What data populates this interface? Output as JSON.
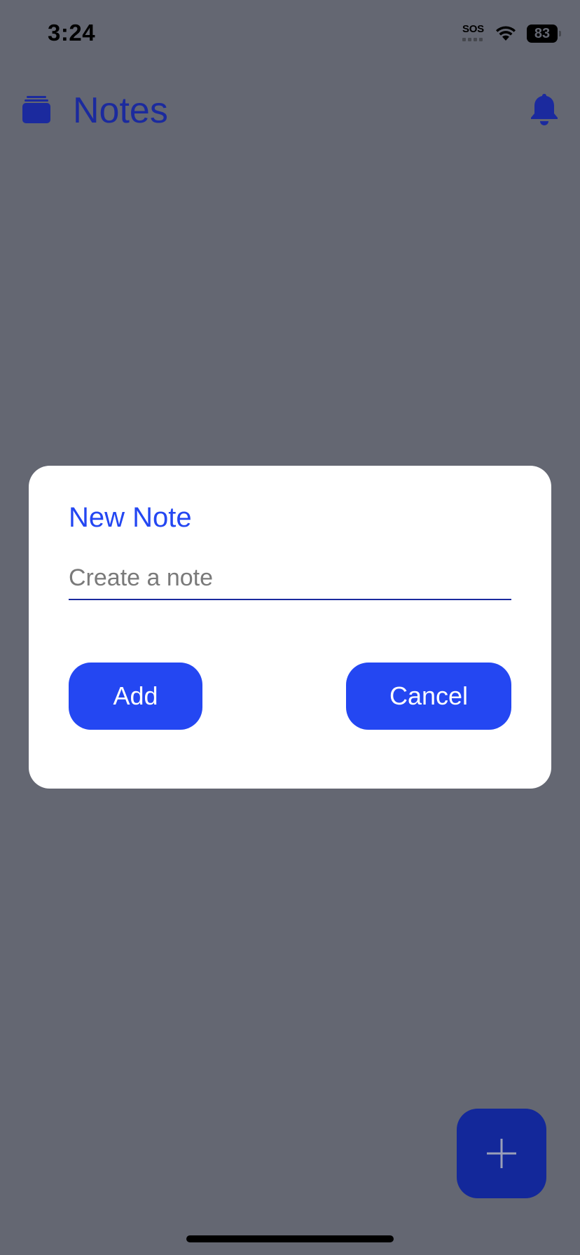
{
  "status_bar": {
    "time": "3:24",
    "sos": "SOS",
    "battery": "83"
  },
  "header": {
    "title": "Notes",
    "logo_icon": "notes-stack-icon",
    "bell_icon": "bell-icon"
  },
  "dialog": {
    "title": "New Note",
    "input_placeholder": "Create a note",
    "input_value": "",
    "add_label": "Add",
    "cancel_label": "Cancel"
  },
  "fab": {
    "icon": "plus-icon"
  },
  "colors": {
    "background_overlay": "#646772",
    "header_blue": "#1b2a9e",
    "accent_blue": "#2447f2",
    "fab_blue": "#13289a",
    "dialog_bg": "#ffffff"
  }
}
